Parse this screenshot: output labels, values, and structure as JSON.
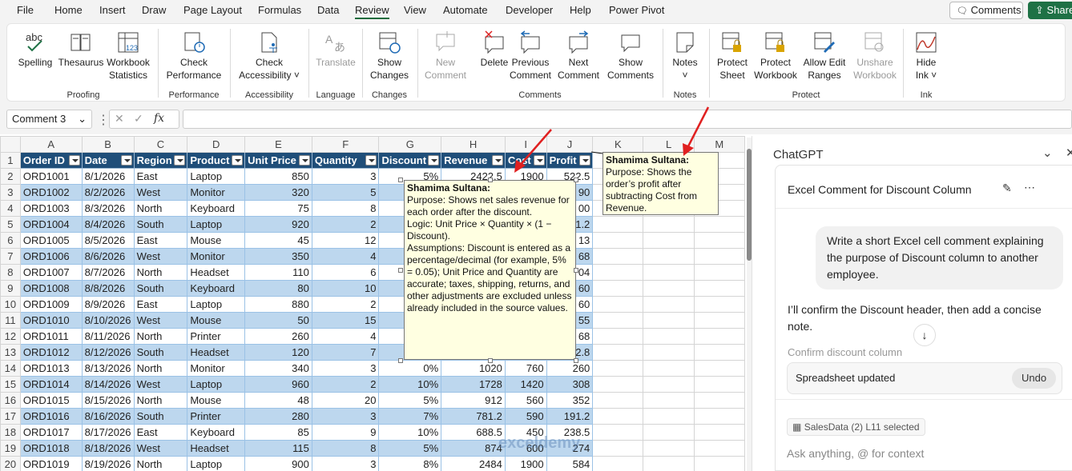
{
  "menu": [
    "File",
    "Home",
    "Insert",
    "Draw",
    "Page Layout",
    "Formulas",
    "Data",
    "Review",
    "View",
    "Automate",
    "Developer",
    "Help",
    "Power Pivot"
  ],
  "menu_active": "Review",
  "top_buttons": {
    "comments": "Comments",
    "share": "Share"
  },
  "ribbon": {
    "groups": [
      "Proofing",
      "Performance",
      "Accessibility",
      "Language",
      "Changes",
      "Comments",
      "Notes",
      "Protect",
      "Ink"
    ],
    "buttons": {
      "spelling": "Spelling",
      "thesaurus": "Thesaurus",
      "workbook_stats_1": "Workbook",
      "workbook_stats_2": "Statistics",
      "check_perf_1": "Check",
      "check_perf_2": "Performance",
      "check_access_1": "Check",
      "check_access_2": "Accessibility ˅",
      "translate": "Translate",
      "show_changes_1": "Show",
      "show_changes_2": "Changes",
      "new_comment_1": "New",
      "new_comment_2": "Comment",
      "delete": "Delete",
      "prev_comment_1": "Previous",
      "prev_comment_2": "Comment",
      "next_comment_1": "Next",
      "next_comment_2": "Comment",
      "show_comments_1": "Show",
      "show_comments_2": "Comments",
      "notes_1": "Notes",
      "notes_2": "˅",
      "protect_sheet_1": "Protect",
      "protect_sheet_2": "Sheet",
      "protect_wb_1": "Protect",
      "protect_wb_2": "Workbook",
      "allow_edit_1": "Allow Edit",
      "allow_edit_2": "Ranges",
      "unshare_1": "Unshare",
      "unshare_2": "Workbook",
      "hide_ink_1": "Hide",
      "hide_ink_2": "Ink ˅"
    }
  },
  "formula_bar": {
    "name_box": "Comment 3",
    "fx": "fx"
  },
  "columns": [
    "A",
    "B",
    "C",
    "D",
    "E",
    "F",
    "G",
    "H",
    "I",
    "J",
    "K",
    "L",
    "M"
  ],
  "headers": [
    "Order ID",
    "Date",
    "Region",
    "Product",
    "Unit Price",
    "Quantity",
    "Discount",
    "Revenue",
    "Cost",
    "Profit"
  ],
  "rows": [
    [
      "ORD1001",
      "8/1/2026",
      "East",
      "Laptop",
      "850",
      "3",
      "5%",
      "2422.5",
      "1900",
      "522.5"
    ],
    [
      "ORD1002",
      "8/2/2026",
      "West",
      "Monitor",
      "320",
      "5",
      "",
      "",
      "",
      "90"
    ],
    [
      "ORD1003",
      "8/3/2026",
      "North",
      "Keyboard",
      "75",
      "8",
      "",
      "",
      "",
      "00"
    ],
    [
      "ORD1004",
      "8/4/2026",
      "South",
      "Laptop",
      "920",
      "2",
      "",
      "",
      "",
      "1.2"
    ],
    [
      "ORD1005",
      "8/5/2026",
      "East",
      "Mouse",
      "45",
      "12",
      "",
      "",
      "",
      "13"
    ],
    [
      "ORD1006",
      "8/6/2026",
      "West",
      "Monitor",
      "350",
      "4",
      "",
      "",
      "",
      "68"
    ],
    [
      "ORD1007",
      "8/7/2026",
      "North",
      "Headset",
      "110",
      "6",
      "",
      "",
      "",
      "04"
    ],
    [
      "ORD1008",
      "8/8/2026",
      "South",
      "Keyboard",
      "80",
      "10",
      "",
      "",
      "",
      "60"
    ],
    [
      "ORD1009",
      "8/9/2026",
      "East",
      "Laptop",
      "880",
      "2",
      "",
      "",
      "",
      "60"
    ],
    [
      "ORD1010",
      "8/10/2026",
      "West",
      "Mouse",
      "50",
      "15",
      "",
      "",
      "",
      "55"
    ],
    [
      "ORD1011",
      "8/11/2026",
      "North",
      "Printer",
      "260",
      "4",
      "",
      "",
      "",
      "68"
    ],
    [
      "ORD1012",
      "8/12/2026",
      "South",
      "Headset",
      "120",
      "7",
      "",
      "",
      "",
      "2.8"
    ],
    [
      "ORD1013",
      "8/13/2026",
      "North",
      "Monitor",
      "340",
      "3",
      "0%",
      "1020",
      "760",
      "260"
    ],
    [
      "ORD1014",
      "8/14/2026",
      "West",
      "Laptop",
      "960",
      "2",
      "10%",
      "1728",
      "1420",
      "308"
    ],
    [
      "ORD1015",
      "8/15/2026",
      "North",
      "Mouse",
      "48",
      "20",
      "5%",
      "912",
      "560",
      "352"
    ],
    [
      "ORD1016",
      "8/16/2026",
      "South",
      "Printer",
      "280",
      "3",
      "7%",
      "781.2",
      "590",
      "191.2"
    ],
    [
      "ORD1017",
      "8/17/2026",
      "East",
      "Keyboard",
      "85",
      "9",
      "10%",
      "688.5",
      "450",
      "238.5"
    ],
    [
      "ORD1018",
      "8/18/2026",
      "West",
      "Headset",
      "115",
      "8",
      "5%",
      "874",
      "600",
      "274"
    ],
    [
      "ORD1019",
      "8/19/2026",
      "North",
      "Laptop",
      "900",
      "3",
      "8%",
      "2484",
      "1900",
      "584"
    ]
  ],
  "comment_revenue": {
    "author": "Shamima Sultana:",
    "body": "Purpose: Shows net sales revenue for each order after the discount.\nLogic: Unit Price × Quantity × (1 − Discount).\nAssumptions: Discount is entered as a percentage/decimal (for example, 5% = 0.05); Unit Price and Quantity are accurate; taxes, shipping, returns, and other adjustments are excluded unless already included in the source values."
  },
  "comment_profit": {
    "author": "Shamima Sultana:",
    "body": "Purpose: Shows the order’s profit after subtracting Cost from Revenue."
  },
  "watermark": "exceldemy",
  "chat": {
    "title": "ChatGPT",
    "conversation": "Excel Comment for Discount Column",
    "user_message": "Write a short Excel cell comment explaining the purpose of Discount column to another employee.",
    "assistant_message": "I’ll confirm the Discount header, then add a concise note.",
    "step": "Confirm discount column",
    "status": "Spreadsheet updated",
    "undo": "Undo",
    "context_chip": "SalesData (2) L11 selected",
    "input_placeholder": "Ask anything, @ for context"
  },
  "colors": {
    "header": "#1f4e79",
    "band": "#bdd7ee",
    "accent": "#1e7145",
    "comment_bg": "#ffffe1",
    "arrow": "#e02020"
  }
}
